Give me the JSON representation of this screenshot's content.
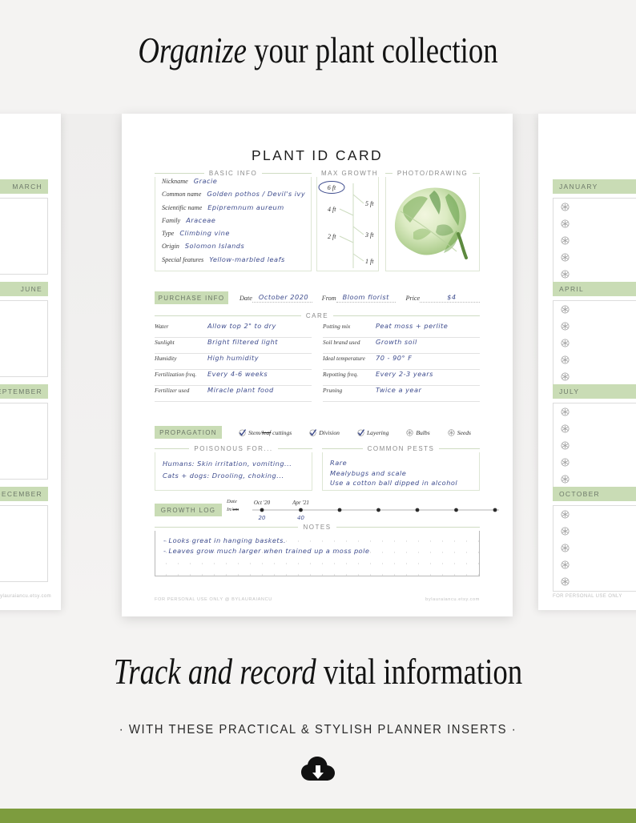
{
  "promo": {
    "headline_top_italic": "Organize",
    "headline_top_roman": " your plant collection",
    "headline_bottom_italic": "Track and record",
    "headline_bottom_roman": " vital information",
    "subline": "· WITH THESE PRACTICAL & STYLISH PLANNER INSERTS ·",
    "download_icon": "cloud-download-icon",
    "accent_green": "#7d9c3e",
    "tag_green": "#c9dcb5",
    "ink_blue": "#3f4d8e"
  },
  "card": {
    "title": "PLANT ID CARD",
    "footer_left": "FOR PERSONAL USE ONLY @ BYLAURAIANCU",
    "footer_right": "bylauraiancu.etsy.com",
    "basic_info": {
      "caption": "BASIC INFO",
      "rows": [
        {
          "label": "Nickname",
          "value": "Gracie"
        },
        {
          "label": "Common name",
          "value": "Golden pothos / Devil's ivy"
        },
        {
          "label": "Scientific name",
          "value": "Epipremnum aureum"
        },
        {
          "label": "Family",
          "value": "Araceae"
        },
        {
          "label": "Type",
          "value": "Climbing vine"
        },
        {
          "label": "Origin",
          "value": "Solomon Islands"
        },
        {
          "label": "Special features",
          "value": "Yellow-marbled leafs"
        }
      ]
    },
    "max_growth": {
      "caption": "MAX GROWTH",
      "selected": "6 ft",
      "ticks": [
        "6 ft",
        "5 ft",
        "4 ft",
        "3 ft",
        "2 ft",
        "1 ft"
      ]
    },
    "photo": {
      "caption": "PHOTO/DRAWING",
      "image": "variegated-pothos-leaf"
    },
    "purchase": {
      "tag": "PURCHASE INFO",
      "date_label": "Date",
      "date_value": "October 2020",
      "from_label": "From",
      "from_value": "Bloom florist",
      "price_label": "Price",
      "price_value": "$4"
    },
    "care": {
      "caption": "CARE",
      "left": [
        {
          "label": "Water",
          "value": "Allow top 2\" to dry"
        },
        {
          "label": "Sunlight",
          "value": "Bright filtered light"
        },
        {
          "label": "Humidity",
          "value": "High humidity"
        },
        {
          "label": "Fertilization freq.",
          "value": "Every 4-6 weeks"
        },
        {
          "label": "Fertilizer used",
          "value": "Miracle plant food"
        }
      ],
      "right": [
        {
          "label": "Potting mix",
          "value": "Peat moss + perlite"
        },
        {
          "label": "Soil brand used",
          "value": "Growth soil"
        },
        {
          "label": "Ideal temperature",
          "value": "70 - 90° F"
        },
        {
          "label": "Repotting freq.",
          "value": "Every 2-3 years"
        },
        {
          "label": "Pruning",
          "value": "Twice a year"
        }
      ]
    },
    "propagation": {
      "tag": "PROPAGATION",
      "items": [
        {
          "label_a": "Stem/",
          "label_strike": "leaf",
          "label_b": " cuttings",
          "checked": true
        },
        {
          "label_a": "Division",
          "label_strike": "",
          "label_b": "",
          "checked": true
        },
        {
          "label_a": "Layering",
          "label_strike": "",
          "label_b": "",
          "checked": true
        },
        {
          "label_a": "Bulbs",
          "label_strike": "",
          "label_b": "",
          "checked": false
        },
        {
          "label_a": "Seeds",
          "label_strike": "",
          "label_b": "",
          "checked": false
        }
      ]
    },
    "poisonous": {
      "caption": "POISONOUS FOR...",
      "lines": [
        "Humans: Skin irritation, vomiting...",
        "Cats + dogs: Drooling, choking..."
      ]
    },
    "pests": {
      "caption": "COMMON PESTS",
      "lines": [
        "Rare",
        "Mealybugs and scale",
        "Use a cotton ball dipped in alcohol"
      ]
    },
    "growth_log": {
      "tag": "GROWTH LOG",
      "axis_label_top": "Date",
      "axis_label_bottom_a": "In/",
      "axis_label_bottom_b": "cm",
      "points": [
        {
          "date": "Oct '20",
          "value": "20"
        },
        {
          "date": "Apr '21",
          "value": "40"
        },
        {
          "date": "",
          "value": ""
        },
        {
          "date": "",
          "value": ""
        },
        {
          "date": "",
          "value": ""
        },
        {
          "date": "",
          "value": ""
        },
        {
          "date": "",
          "value": ""
        }
      ]
    },
    "notes": {
      "caption": "NOTES",
      "lines": [
        "- Looks great in hanging baskets.",
        "- Leaves grow much larger when trained up a moss pole"
      ]
    }
  },
  "sheet_left": {
    "months": [
      "MARCH",
      "JUNE",
      "SEPTEMBER",
      "DECEMBER"
    ],
    "footer": "bylauraiancu.etsy.com"
  },
  "sheet_right": {
    "months": [
      "JANUARY",
      "APRIL",
      "JULY",
      "OCTOBER"
    ],
    "rows_per_month": 5,
    "row_icon": "flower-icon",
    "footer": "FOR PERSONAL USE ONLY"
  }
}
